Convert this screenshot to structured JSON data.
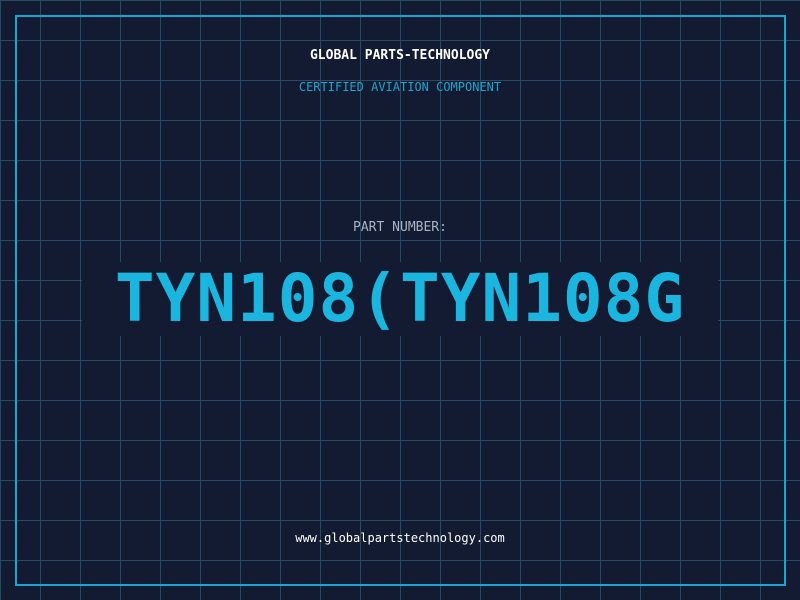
{
  "header": {
    "company": "GLOBAL PARTS-TECHNOLOGY",
    "tagline": "CERTIFIED AVIATION COMPONENT"
  },
  "part": {
    "label": "PART NUMBER:",
    "number": "TYN108(TYN108G"
  },
  "footer": {
    "url": "www.globalpartstechnology.com"
  },
  "colors": {
    "background": "#121b31",
    "grid": "#24566e",
    "accent": "#1aa6cf",
    "part_number": "#1ab6df",
    "label": "#a9b4c4",
    "text": "#ffffff"
  }
}
